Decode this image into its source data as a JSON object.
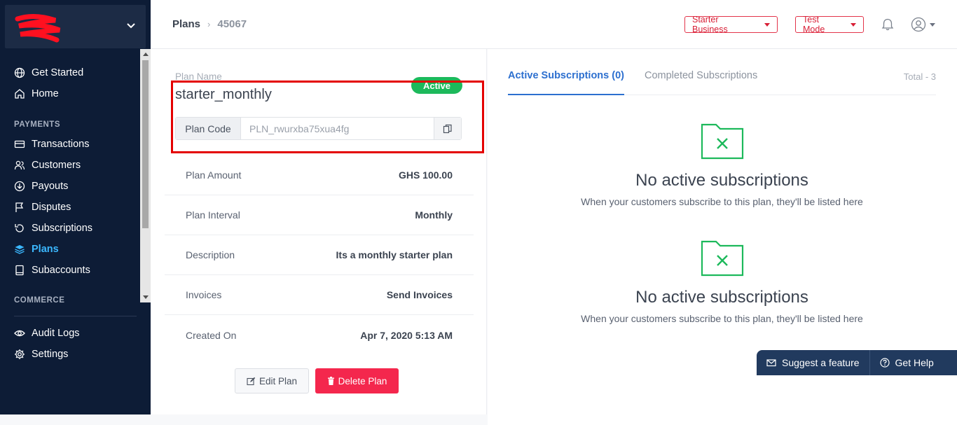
{
  "sidebar": {
    "items": [
      {
        "label": "Get Started",
        "icon": "globe-icon"
      },
      {
        "label": "Home",
        "icon": "home-icon"
      }
    ],
    "payments_section": "PAYMENTS",
    "payments_items": [
      {
        "label": "Transactions",
        "icon": "card-icon"
      },
      {
        "label": "Customers",
        "icon": "users-icon"
      },
      {
        "label": "Payouts",
        "icon": "payout-icon"
      },
      {
        "label": "Disputes",
        "icon": "flag-icon"
      },
      {
        "label": "Subscriptions",
        "icon": "refresh-icon"
      },
      {
        "label": "Plans",
        "icon": "layers-icon"
      },
      {
        "label": "Subaccounts",
        "icon": "book-icon"
      }
    ],
    "commerce_section": "COMMERCE",
    "bottom_items": [
      {
        "label": "Audit Logs",
        "icon": "eye-icon"
      },
      {
        "label": "Settings",
        "icon": "gear-icon"
      }
    ]
  },
  "header": {
    "breadcrumb_root": "Plans",
    "breadcrumb_current": "45067",
    "plan_selector": "Starter Business",
    "mode_selector": "Test Mode"
  },
  "plan": {
    "name_label": "Plan Name",
    "name": "starter_monthly",
    "status": "Active",
    "code_label": "Plan Code",
    "code": "PLN_rwurxba75xua4fg",
    "details": [
      {
        "label": "Plan Amount",
        "value": "GHS 100.00"
      },
      {
        "label": "Plan Interval",
        "value": "Monthly"
      },
      {
        "label": "Description",
        "value": "Its a monthly starter plan"
      },
      {
        "label": "Invoices",
        "value": "Send Invoices"
      },
      {
        "label": "Created On",
        "value": "Apr 7, 2020 5:13 AM"
      }
    ],
    "edit_label": "Edit Plan",
    "delete_label": "Delete Plan"
  },
  "subscriptions": {
    "tab_active": "Active Subscriptions (0)",
    "tab_completed": "Completed Subscriptions",
    "total": "Total - 3",
    "empty_title": "No active subscriptions",
    "empty_subtitle": "When your customers subscribe to this plan, they'll be listed here"
  },
  "help": {
    "suggest": "Suggest a feature",
    "get_help": "Get Help"
  },
  "colors": {
    "sidebar_bg": "#0d1c36",
    "accent": "#3bb8ff",
    "danger": "#f4274d",
    "success": "#1db95b"
  }
}
